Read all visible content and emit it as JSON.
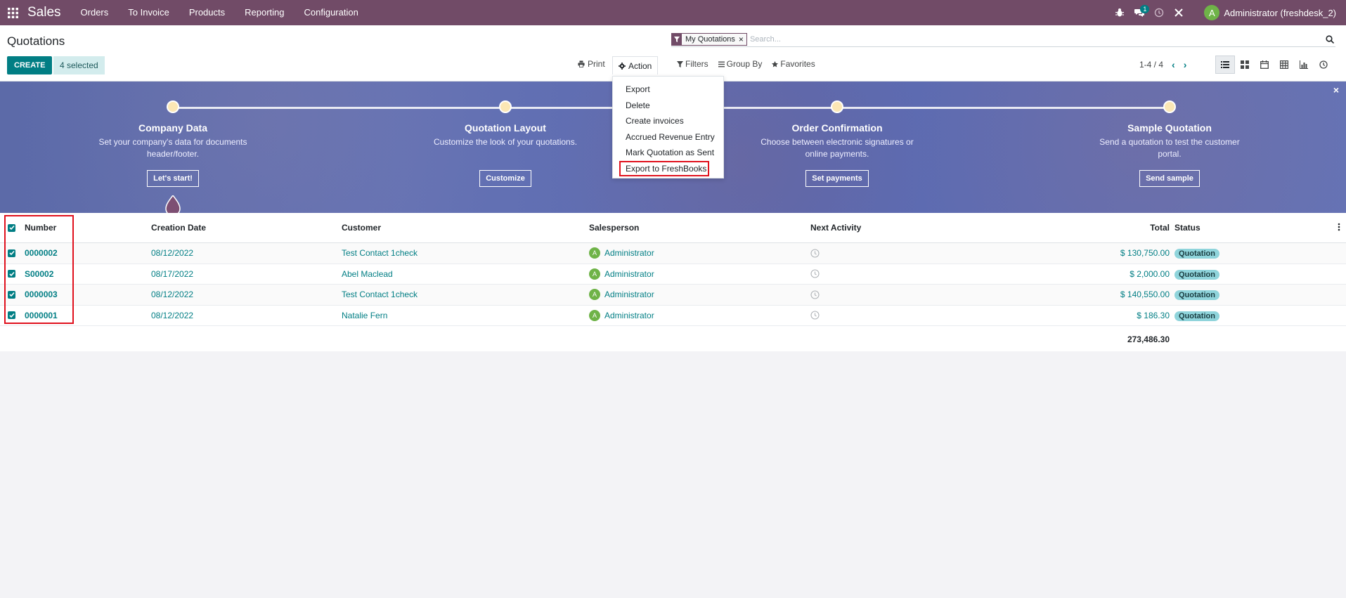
{
  "navbar": {
    "app_name": "Sales",
    "menu": [
      "Orders",
      "To Invoice",
      "Products",
      "Reporting",
      "Configuration"
    ],
    "message_count": "1",
    "user_initial": "A",
    "user_name": "Administrator (freshdesk_2)"
  },
  "control_panel": {
    "title": "Quotations",
    "create_label": "CREATE",
    "selected_label": "4 selected",
    "print_label": "Print",
    "action_label": "Action",
    "search": {
      "facet_label": "My Quotations",
      "facet_close": "×",
      "placeholder": "Search..."
    },
    "filters_label": "Filters",
    "group_by_label": "Group By",
    "favorites_label": "Favorites",
    "pager": "1-4 / 4"
  },
  "action_menu": {
    "items": [
      "Export",
      "Delete",
      "Create invoices",
      "Accrued Revenue Entry",
      "Mark Quotation as Sent",
      "Export to FreshBooks"
    ],
    "highlighted": "Export to FreshBooks"
  },
  "banner": {
    "close": "×",
    "steps": [
      {
        "title": "Company Data",
        "desc": "Set your company's data for documents header/footer.",
        "button": "Let's start!"
      },
      {
        "title": "Quotation Layout",
        "desc": "Customize the look of your quotations.",
        "button": "Customize"
      },
      {
        "title": "Order Confirmation",
        "desc": "Choose between electronic signatures or online payments.",
        "button": "Set payments"
      },
      {
        "title": "Sample Quotation",
        "desc": "Send a quotation to test the customer portal.",
        "button": "Send sample"
      }
    ]
  },
  "table": {
    "columns": [
      "Number",
      "Creation Date",
      "Customer",
      "Salesperson",
      "Next Activity",
      "Total",
      "Status"
    ],
    "rows": [
      {
        "number": "0000002",
        "date": "08/12/2022",
        "customer": "Test Contact 1check",
        "salesperson": "Administrator",
        "avatar": "A",
        "total": "$ 130,750.00",
        "status": "Quotation"
      },
      {
        "number": "S00002",
        "date": "08/17/2022",
        "customer": "Abel Maclead",
        "salesperson": "Administrator",
        "avatar": "A",
        "total": "$ 2,000.00",
        "status": "Quotation"
      },
      {
        "number": "0000003",
        "date": "08/12/2022",
        "customer": "Test Contact 1check",
        "salesperson": "Administrator",
        "avatar": "A",
        "total": "$ 140,550.00",
        "status": "Quotation"
      },
      {
        "number": "0000001",
        "date": "08/12/2022",
        "customer": "Natalie Fern",
        "salesperson": "Administrator",
        "avatar": "A",
        "total": "$ 186.30",
        "status": "Quotation"
      }
    ],
    "sum_total": "273,486.30"
  },
  "colors": {
    "brand": "#714b67",
    "primary": "#017e84",
    "highlight": "#e0111d"
  }
}
